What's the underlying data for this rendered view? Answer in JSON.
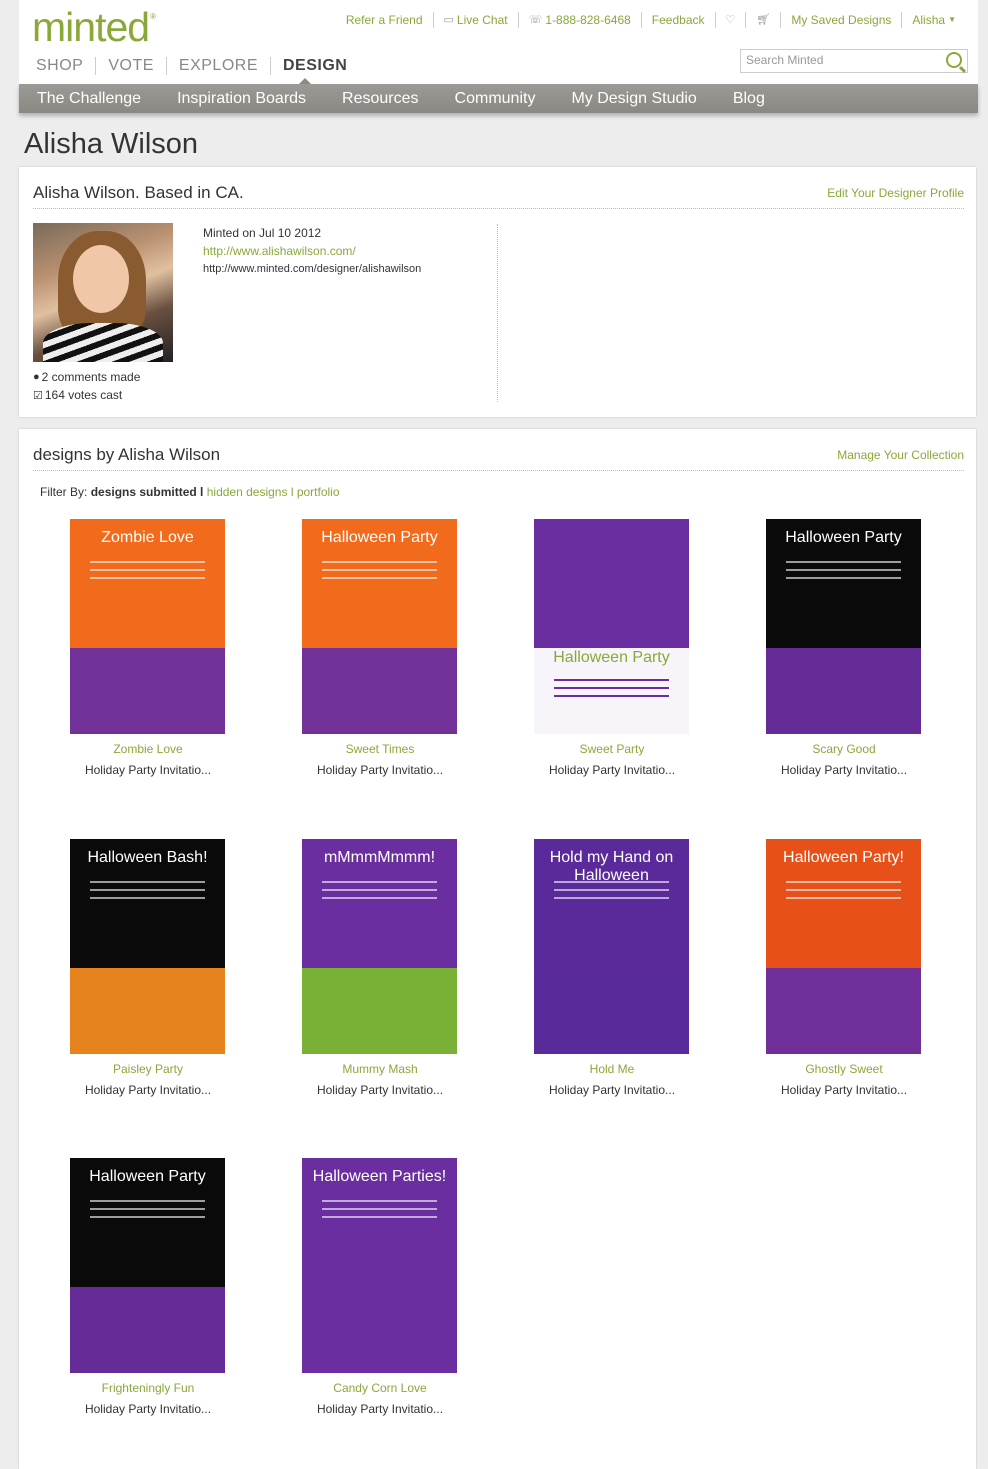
{
  "header": {
    "logo": "minted",
    "logo_mark": "®",
    "util": {
      "refer": "Refer a Friend",
      "chat": "Live Chat",
      "phone": "1-888-828-6468",
      "feedback": "Feedback",
      "saved": "My Saved Designs",
      "user": "Alisha"
    },
    "main_nav": [
      "SHOP",
      "VOTE",
      "EXPLORE",
      "DESIGN"
    ],
    "search_placeholder": "Search Minted"
  },
  "subnav": [
    "The Challenge",
    "Inspiration Boards",
    "Resources",
    "Community",
    "My Design Studio",
    "Blog"
  ],
  "page_title": "Alisha Wilson",
  "profile": {
    "heading": "Alisha Wilson. Based in CA.",
    "edit_link": "Edit Your Designer Profile",
    "minted_on": "Minted on Jul 10 2012",
    "website": "http://www.alishawilson.com/",
    "minted_url": "http://www.minted.com/designer/alishawilson",
    "comments": "2 comments made",
    "votes": "164 votes cast"
  },
  "designs": {
    "heading": "designs by Alisha Wilson",
    "manage_link": "Manage Your Collection",
    "filter_label": "Filter By:",
    "filter_active": "designs submitted",
    "filter_sep": "l",
    "filter_hidden": "hidden designs",
    "filter_portfolio": "portfolio",
    "filter_bar": "l",
    "items": [
      {
        "name": "Zombie Love",
        "category": "Holiday Party Invitatio...",
        "title": "Zombie Love",
        "bg": "#f26a1b",
        "band": "#6a2ea0"
      },
      {
        "name": "Sweet Times",
        "category": "Holiday Party Invitatio...",
        "title": "Halloween Party",
        "bg": "#f26a1b",
        "band": "#6a2ea0"
      },
      {
        "name": "Sweet Party",
        "category": "Holiday Party Invitatio...",
        "title": "Halloween Party",
        "bg": "#6a2ea0",
        "band": "#ffffff"
      },
      {
        "name": "Scary Good",
        "category": "Holiday Party Invitatio...",
        "title": "Halloween Party",
        "bg": "#0a0a0a",
        "band": "#6a2ea0"
      },
      {
        "name": "Paisley Party",
        "category": "Holiday Party Invitatio...",
        "title": "Halloween Bash!",
        "bg": "#0a0a0a",
        "band": "#f28a20"
      },
      {
        "name": "Mummy Mash",
        "category": "Holiday Party Invitatio...",
        "title": "mMmmMmmm!",
        "bg": "#6a2ea0",
        "band": "#7ab830"
      },
      {
        "name": "Hold Me",
        "category": "Holiday Party Invitatio...",
        "title": "Hold my Hand on Halloween",
        "bg": "#5a2a9a",
        "band": "#5a2a9a"
      },
      {
        "name": "Ghostly Sweet",
        "category": "Holiday Party Invitatio...",
        "title": "Halloween Party!",
        "bg": "#e8501a",
        "band": "#6a2ea0"
      },
      {
        "name": "Frighteningly Fun",
        "category": "Holiday Party Invitatio...",
        "title": "Halloween Party",
        "bg": "#0a0a0a",
        "band": "#6a2ea0"
      },
      {
        "name": "Candy Corn Love",
        "category": "Holiday Party Invitatio...",
        "title": "Halloween Parties!",
        "bg": "#6a2ea0",
        "band": "#6a2ea0"
      }
    ]
  }
}
